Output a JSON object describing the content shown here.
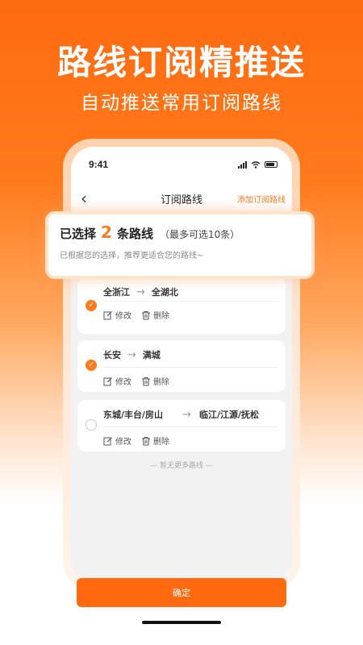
{
  "promo": {
    "headline": "路线订阅精推送",
    "subheadline": "自动推送常用订阅路线"
  },
  "status_bar": {
    "time": "9:41"
  },
  "nav": {
    "title": "订阅路线",
    "action": "添加订阅路线",
    "back_icon": "chevron-left-icon"
  },
  "selection": {
    "prefix": "已选择",
    "count": "2",
    "suffix": "条路线",
    "note": "（最多可选10条）",
    "description": "已根据您的选择，推荐更适合您的路线~"
  },
  "routes": [
    {
      "from": "全浙江",
      "to": "全湖北",
      "checked": true
    },
    {
      "from": "长安",
      "to": "满城",
      "checked": true
    },
    {
      "from": "东城/丰台/房山",
      "to": "临江/江源/抚松",
      "checked": false
    }
  ],
  "route_actions": {
    "edit": "修改",
    "delete": "删除"
  },
  "list_footer": "— 暂无更多路线 —",
  "confirm": "确定",
  "colors": {
    "accent": "#ff7a1c",
    "button": "#ff6a10"
  }
}
